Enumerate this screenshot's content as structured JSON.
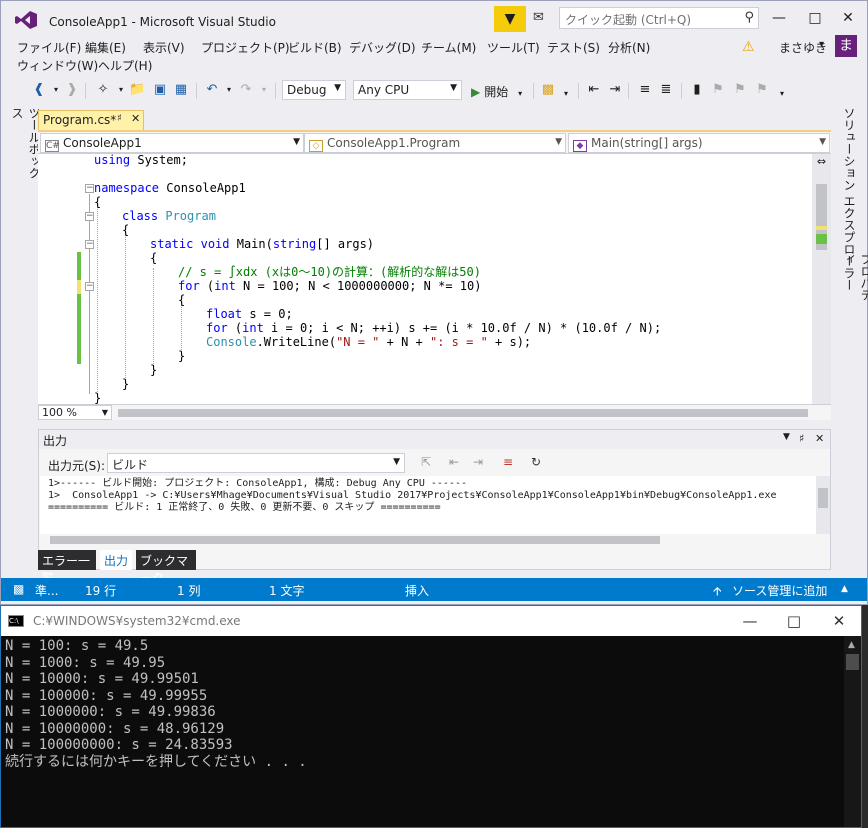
{
  "vs": {
    "title": "ConsoleApp1 - Microsoft Visual Studio",
    "quick_launch_placeholder": "クイック起動 (Ctrl+Q)",
    "menu": [
      "ファイル(F)",
      "編集(E)",
      "表示(V)",
      "プロジェクト(P)",
      "ビルド(B)",
      "デバッグ(D)",
      "チーム(M)",
      "ツール(T)",
      "テスト(S)",
      "分析(N)",
      "ウィンドウ(W)",
      "ヘルプ(H)"
    ],
    "user_name": "まさゆき",
    "avatar_letter": "ま",
    "toolbar": {
      "config": "Debug",
      "platform": "Any CPU",
      "start_label": "開始"
    },
    "left_tool_tab": "ツールボックス",
    "right_tool_tabs": [
      "ソリューション エクスプローラー",
      "プロパティ"
    ],
    "doc_tab": "Program.cs*",
    "nav": {
      "project": "ConsoleApp1",
      "type": "ConsoleApp1.Program",
      "member": "Main(string[] args)"
    },
    "zoom": "100 %",
    "output": {
      "title": "出力",
      "source_label": "出力元(S):",
      "source_value": "ビルド",
      "lines": [
        "1>------ ビルド開始: プロジェクト: ConsoleApp1, 構成: Debug Any CPU ------",
        "1>  ConsoleApp1 -> C:¥Users¥Mhage¥Documents¥Visual Studio 2017¥Projects¥ConsoleApp1¥ConsoleApp1¥bin¥Debug¥ConsoleApp1.exe",
        "========== ビルド: 1 正常終了、0 失敗、0 更新不要、0 スキップ =========="
      ]
    },
    "bottom_tabs": [
      "エラー一覧",
      "出力",
      "ブックマーク"
    ],
    "status": {
      "state": "準...",
      "line": "19 行",
      "col": "1 列",
      "chars": "1 文字",
      "mode": "挿入",
      "source_control": "ソース管理に追加"
    }
  },
  "code": {
    "l1": {
      "a": "using",
      "b": " System;"
    },
    "l2": {
      "a": "namespace",
      "b": " ConsoleApp1"
    },
    "l3": {
      "a": "{"
    },
    "l4": {
      "a": "class",
      "b": " ",
      "c": "Program"
    },
    "l5": {
      "a": "{"
    },
    "l6": {
      "a": "static",
      "b": " ",
      "c": "void",
      "d": " Main(",
      "e": "string",
      "f": "[] args)"
    },
    "l7": {
      "a": "{"
    },
    "l8": {
      "a": "// s = ∫xdx (xは0〜10)の計算：(解析的な解は50)"
    },
    "l9": {
      "a": "for",
      "b": " (",
      "c": "int",
      "d": " N = 100; N < 1000000000; N *= 10)"
    },
    "l10": {
      "a": "{"
    },
    "l11": {
      "a": "float",
      "b": " s = 0;"
    },
    "l12": {
      "a": "for",
      "b": " (",
      "c": "int",
      "d": " i = 0; i < N; ++i) s += (i * 10.0f / N) * (10.0f / N);"
    },
    "l13": {
      "a": "Console",
      "b": ".WriteLine(",
      "c": "\"N = \"",
      "d": " + N + ",
      "e": "\": s = \"",
      "f": " + s);"
    },
    "l14": {
      "a": "}"
    },
    "l15": {
      "a": "}"
    },
    "l16": {
      "a": "}"
    },
    "l17": {
      "a": "}"
    }
  },
  "cmd": {
    "title": "C:¥WINDOWS¥system32¥cmd.exe",
    "lines": [
      "N = 100: s = 49.5",
      "N = 1000: s = 49.95",
      "N = 10000: s = 49.99501",
      "N = 100000: s = 49.99955",
      "N = 1000000: s = 49.99836",
      "N = 10000000: s = 48.96129",
      "N = 100000000: s = 24.83593",
      "続行するには何かキーを押してください . . ."
    ]
  },
  "colors": {
    "status_bar": "#007acc",
    "keyword": "#0000ff",
    "type": "#2b91af",
    "comment": "#008000",
    "string": "#a31515",
    "change_saved": "#6bc146",
    "change_unsaved": "#f1e174"
  }
}
